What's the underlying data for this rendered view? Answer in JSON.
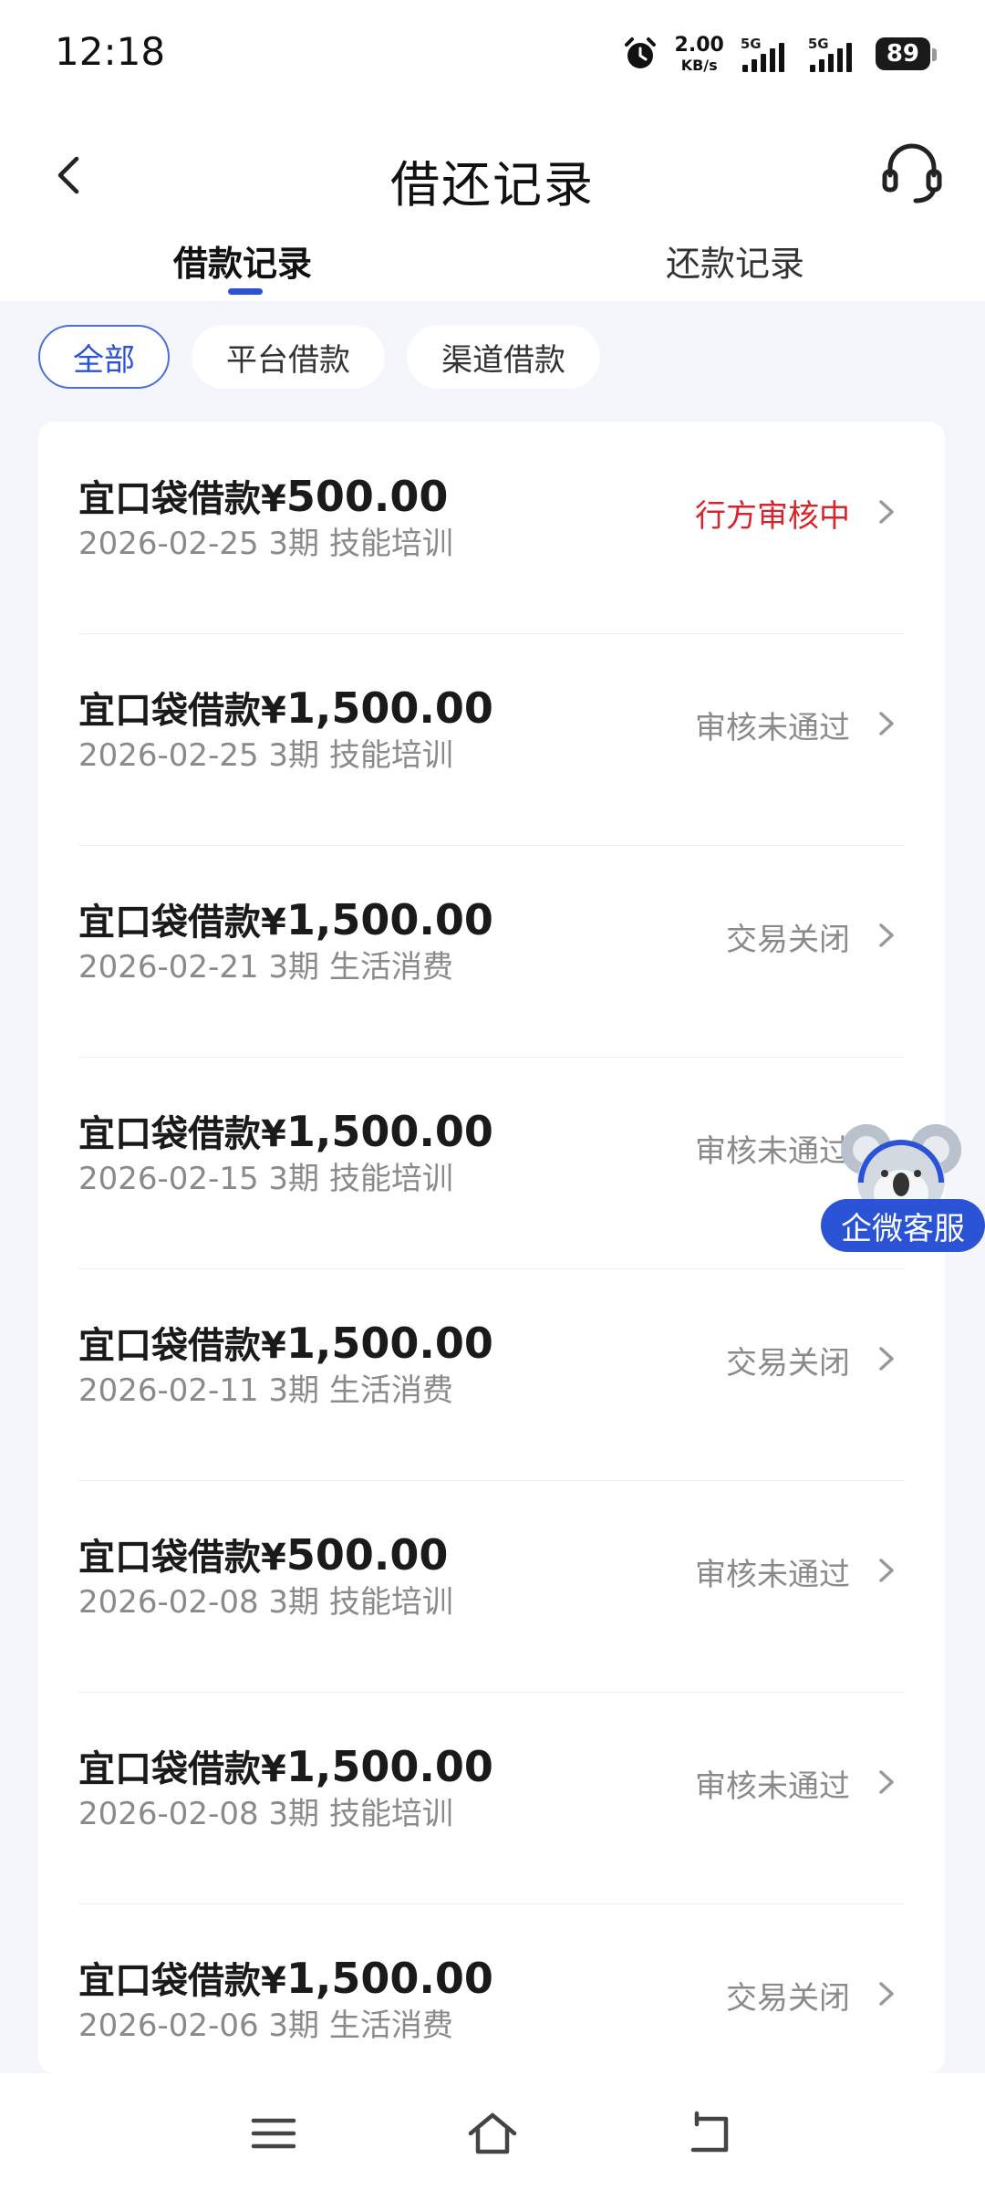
{
  "status_bar": {
    "time": "12:18",
    "net_speed": "2.00",
    "net_unit": "KB/s",
    "sim1": "5G",
    "sim2": "5G",
    "battery": "89"
  },
  "header": {
    "title": "借还记录"
  },
  "tabs": [
    {
      "label": "借款记录",
      "active": true
    },
    {
      "label": "还款记录",
      "active": false
    }
  ],
  "filters": [
    {
      "label": "全部",
      "active": true
    },
    {
      "label": "平台借款",
      "active": false
    },
    {
      "label": "渠道借款",
      "active": false
    }
  ],
  "records": [
    {
      "title": "宜口袋借款¥",
      "amount": "500.00",
      "meta": "2026-02-25 3期  技能培训",
      "status": "行方审核中",
      "status_color": "#d6252c"
    },
    {
      "title": "宜口袋借款¥",
      "amount": "1,500.00",
      "meta": "2026-02-25 3期  技能培训",
      "status": "审核未通过",
      "status_color": "#8a8a8a"
    },
    {
      "title": "宜口袋借款¥",
      "amount": "1,500.00",
      "meta": "2026-02-21 3期  生活消费",
      "status": "交易关闭",
      "status_color": "#8a8a8a"
    },
    {
      "title": "宜口袋借款¥",
      "amount": "1,500.00",
      "meta": "2026-02-15 3期  技能培训",
      "status": "审核未通过",
      "status_color": "#8a8a8a"
    },
    {
      "title": "宜口袋借款¥",
      "amount": "1,500.00",
      "meta": "2026-02-11 3期  生活消费",
      "status": "交易关闭",
      "status_color": "#8a8a8a"
    },
    {
      "title": "宜口袋借款¥",
      "amount": "500.00",
      "meta": "2026-02-08 3期  技能培训",
      "status": "审核未通过",
      "status_color": "#8a8a8a"
    },
    {
      "title": "宜口袋借款¥",
      "amount": "1,500.00",
      "meta": "2026-02-08 3期  技能培训",
      "status": "审核未通过",
      "status_color": "#8a8a8a"
    },
    {
      "title": "宜口袋借款¥",
      "amount": "1,500.00",
      "meta": "2026-02-06 3期  生活消费",
      "status": "交易关闭",
      "status_color": "#8a8a8a"
    }
  ],
  "floating": {
    "label": "企微客服"
  },
  "nav": {
    "icons": [
      "menu-icon",
      "home-icon",
      "back-icon"
    ]
  },
  "colors": {
    "accent": "#2b53d6",
    "status_red": "#d6252c",
    "muted": "#8a8a8a"
  }
}
